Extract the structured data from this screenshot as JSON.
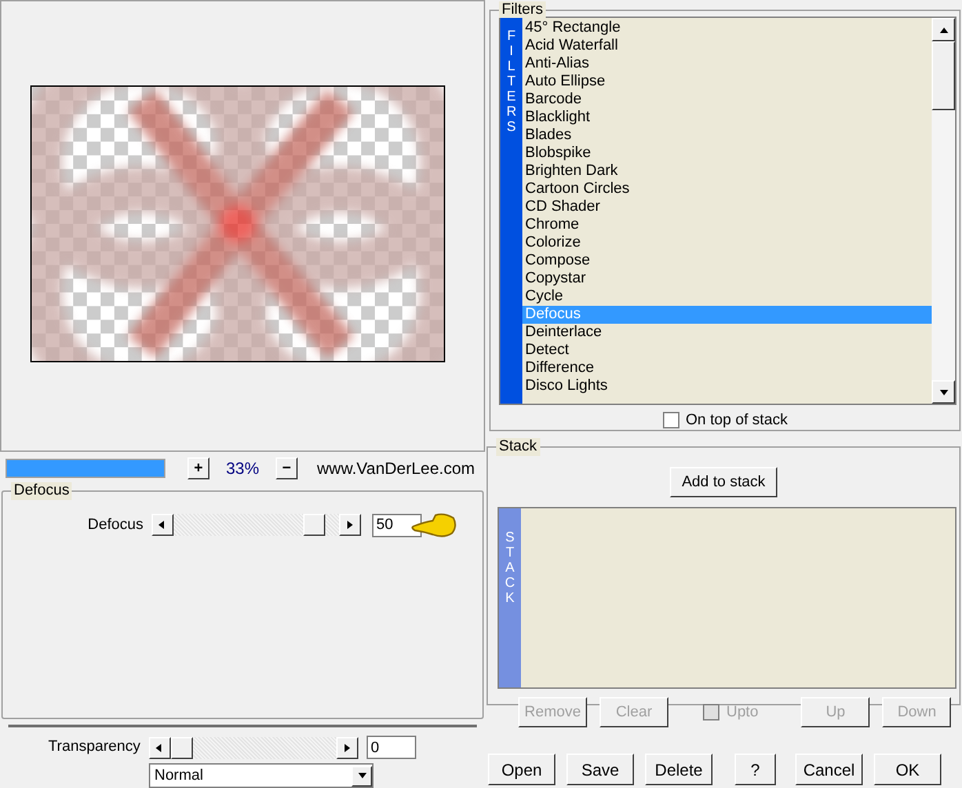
{
  "preview": {
    "level": 1.0,
    "zoom_in": "+",
    "zoom": "33%",
    "zoom_out": "−",
    "website": "www.VanDerLee.com"
  },
  "defocus_group": {
    "title": "Defocus",
    "slider": {
      "label": "Defocus",
      "level": 0.9,
      "value": "50"
    }
  },
  "transparency": {
    "label": "Transparency",
    "level": 0,
    "value": "0",
    "blend_mode": "Normal"
  },
  "filters": {
    "title": "Filters",
    "sidebar_label": "FILTERS",
    "items": [
      {
        "label": "45° Rectangle",
        "selected": false
      },
      {
        "label": "Acid Waterfall",
        "selected": false
      },
      {
        "label": "Anti-Alias",
        "selected": false
      },
      {
        "label": "Auto Ellipse",
        "selected": false
      },
      {
        "label": "Barcode",
        "selected": false
      },
      {
        "label": "Blacklight",
        "selected": false
      },
      {
        "label": "Blades",
        "selected": false
      },
      {
        "label": "Blobspike",
        "selected": false
      },
      {
        "label": "Brighten Dark",
        "selected": false
      },
      {
        "label": "Cartoon Circles",
        "selected": false
      },
      {
        "label": "CD Shader",
        "selected": false
      },
      {
        "label": "Chrome",
        "selected": false
      },
      {
        "label": "Colorize",
        "selected": false
      },
      {
        "label": "Compose",
        "selected": false
      },
      {
        "label": "Copystar",
        "selected": false
      },
      {
        "label": "Cycle",
        "selected": false
      },
      {
        "label": "Defocus",
        "selected": true
      },
      {
        "label": "Deinterlace",
        "selected": false
      },
      {
        "label": "Detect",
        "selected": false
      },
      {
        "label": "Difference",
        "selected": false
      },
      {
        "label": "Disco Lights",
        "selected": false
      }
    ],
    "on_top": {
      "label": "On top of stack",
      "checked": false
    }
  },
  "stack": {
    "title": "Stack",
    "add_button": "Add to stack",
    "sidebar_label": "STACK",
    "buttons": [
      {
        "kind": "button",
        "label": "Remove",
        "disabled": true
      },
      {
        "kind": "button",
        "label": "Clear",
        "disabled": true
      },
      {
        "kind": "checkbox",
        "label": "Upto",
        "disabled": true,
        "checked": false
      },
      {
        "kind": "button",
        "label": "Up",
        "disabled": true
      },
      {
        "kind": "button",
        "label": "Down",
        "disabled": true
      }
    ]
  },
  "footer_buttons": [
    "Open",
    "Save",
    "Delete",
    "?",
    "Cancel",
    "OK"
  ]
}
